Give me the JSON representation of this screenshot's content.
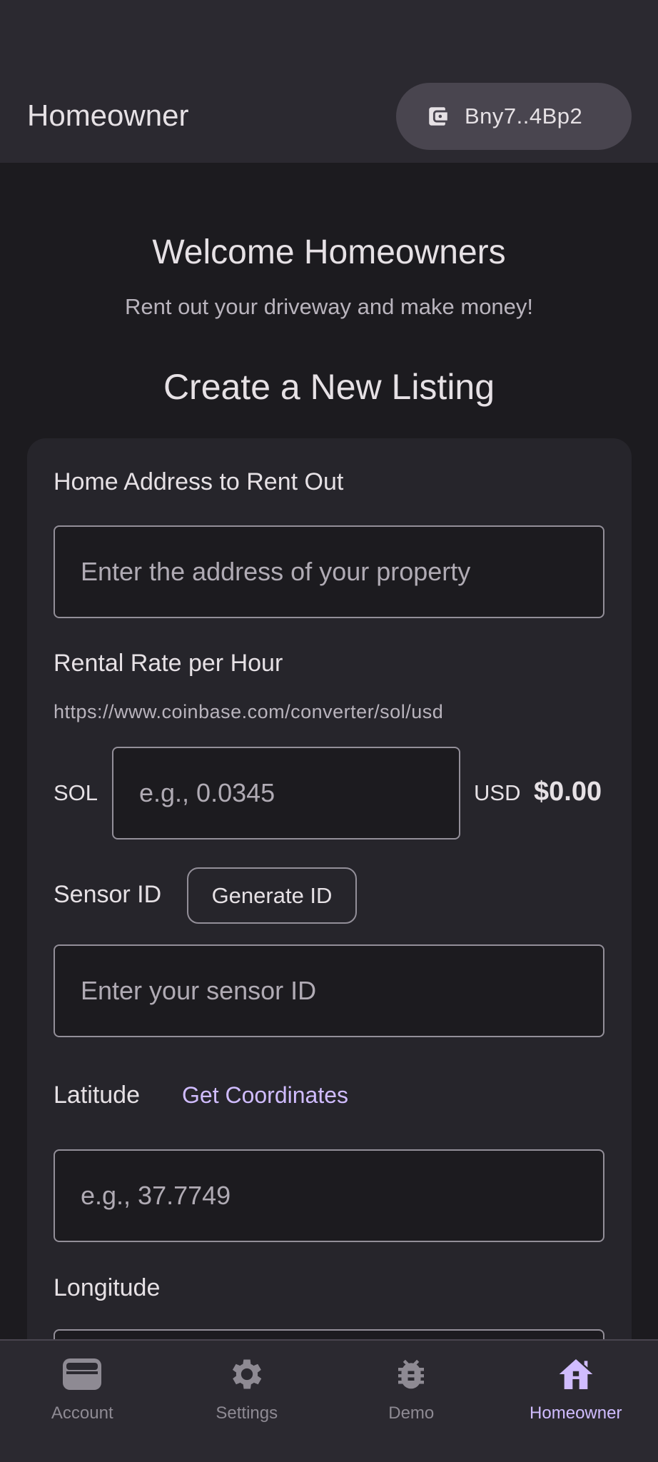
{
  "app_bar": {
    "title": "Homeowner",
    "wallet_label": "Bny7..4Bp2"
  },
  "main": {
    "welcome": "Welcome Homeowners",
    "subtitle": "Rent out your driveway and make money!",
    "section_title": "Create a New Listing"
  },
  "form": {
    "address_label": "Home Address to Rent Out",
    "address_placeholder": "Enter the address of your property",
    "rate_label": "Rental Rate per Hour",
    "rate_helper": "https://www.coinbase.com/converter/sol/usd",
    "sol_label": "SOL",
    "sol_placeholder": "e.g., 0.0345",
    "usd_label": "USD",
    "usd_value": "$0.00",
    "sensor_label": "Sensor ID",
    "generate_button": "Generate ID",
    "sensor_placeholder": "Enter your sensor ID",
    "latitude_label": "Latitude",
    "get_coordinates": "Get Coordinates",
    "latitude_placeholder": "e.g., 37.7749",
    "longitude_label": "Longitude"
  },
  "bottom_nav": {
    "items": [
      {
        "label": "Account",
        "icon": "wallet-icon",
        "active": false
      },
      {
        "label": "Settings",
        "icon": "gear-icon",
        "active": false
      },
      {
        "label": "Demo",
        "icon": "bug-icon",
        "active": false
      },
      {
        "label": "Homeowner",
        "icon": "home-icon",
        "active": true
      }
    ]
  },
  "colors": {
    "background": "#1c1b1f",
    "surface": "#2b2930",
    "card": "#26252b",
    "accent": "#d0bcff",
    "inactive": "#8e8a93"
  }
}
